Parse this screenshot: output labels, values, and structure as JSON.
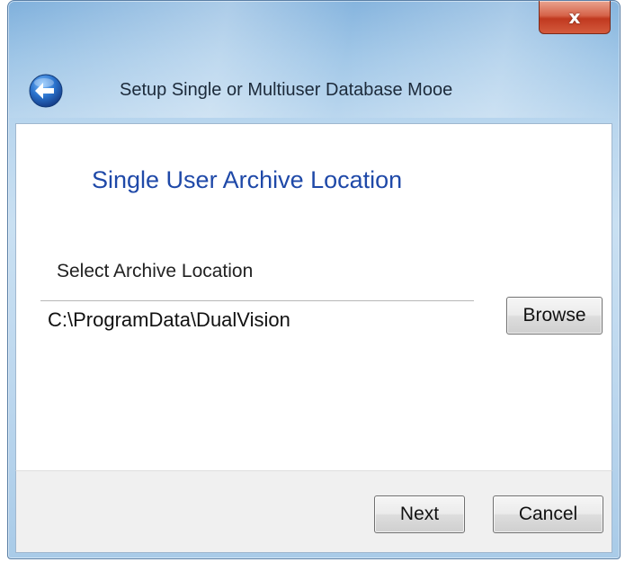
{
  "window": {
    "title": "Setup Single or Multiuser Database Mooe",
    "close_symbol": "x"
  },
  "icons": {
    "back": "back-arrow-icon",
    "close": "close-icon"
  },
  "content": {
    "heading": "Single User Archive Location",
    "field_label": "Select Archive Location",
    "path_value": "C:\\ProgramData\\DualVision",
    "browse_label": "Browse"
  },
  "footer": {
    "next_label": "Next",
    "cancel_label": "Cancel"
  },
  "colors": {
    "heading": "#1f49a8",
    "close_button": "#c0391f",
    "back_button": "#2a72cc"
  }
}
